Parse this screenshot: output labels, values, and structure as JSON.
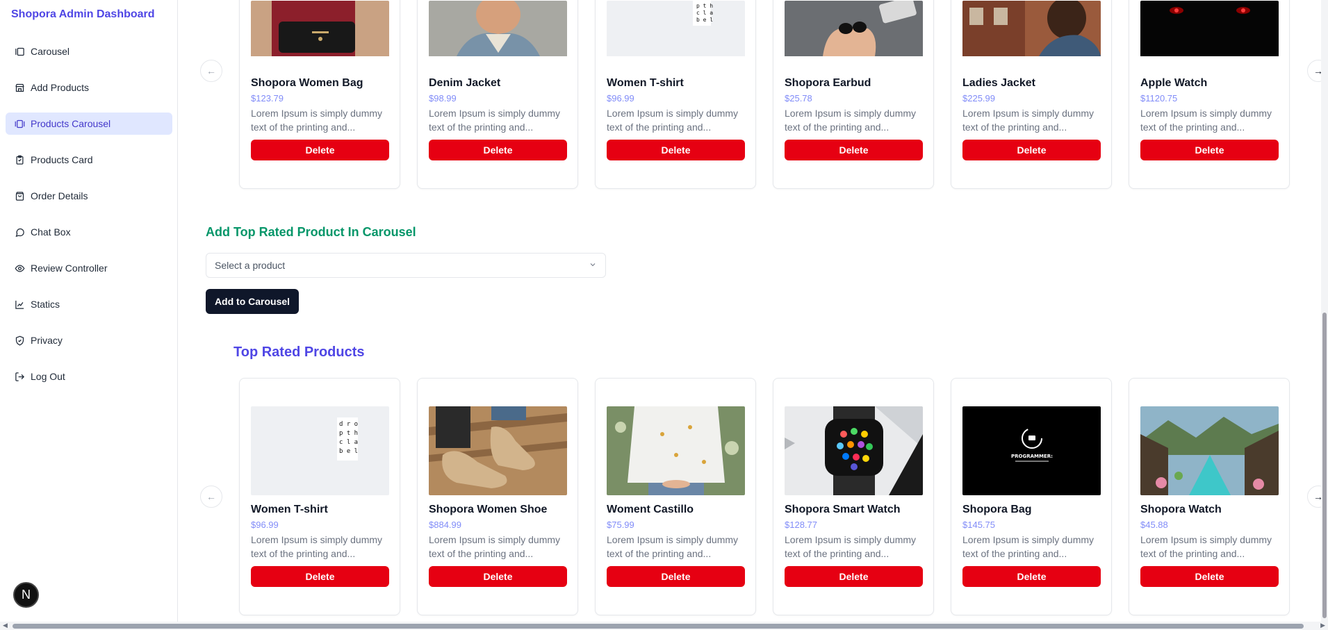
{
  "brand": "Shopora Admin Dashboard",
  "nav": [
    {
      "label": "Carousel",
      "icon": "carousel-icon"
    },
    {
      "label": "Add Products",
      "icon": "store-icon"
    },
    {
      "label": "Products Carousel",
      "icon": "carousel-icon",
      "active": true
    },
    {
      "label": "Products Card",
      "icon": "clipboard-icon"
    },
    {
      "label": "Order Details",
      "icon": "bag-icon"
    },
    {
      "label": "Chat Box",
      "icon": "message-icon"
    },
    {
      "label": "Review Controller",
      "icon": "eye-icon"
    },
    {
      "label": "Statics",
      "icon": "chart-icon"
    },
    {
      "label": "Privacy",
      "icon": "shield-icon"
    },
    {
      "label": "Log Out",
      "icon": "logout-icon"
    }
  ],
  "floating_badge": "N",
  "carousel_products": [
    {
      "name": "Shopora Women Bag",
      "price": "$123.79",
      "desc": "Lorem Ipsum is simply dummy text of the printing and...",
      "delete": "Delete"
    },
    {
      "name": "Denim Jacket",
      "price": "$98.99",
      "desc": "Lorem Ipsum is simply dummy text of the printing and...",
      "delete": "Delete"
    },
    {
      "name": "Women T-shirt",
      "price": "$96.99",
      "desc": "Lorem Ipsum is simply dummy text of the printing and...",
      "delete": "Delete"
    },
    {
      "name": "Shopora Earbud",
      "price": "$25.78",
      "desc": "Lorem Ipsum is simply dummy text of the printing and...",
      "delete": "Delete"
    },
    {
      "name": "Ladies Jacket",
      "price": "$225.99",
      "desc": "Lorem Ipsum is simply dummy text of the printing and...",
      "delete": "Delete"
    },
    {
      "name": "Apple Watch",
      "price": "$1120.75",
      "desc": "Lorem Ipsum is simply dummy text of the printing and...",
      "delete": "Delete"
    }
  ],
  "add_section": {
    "title": "Add Top Rated Product In Carousel",
    "select_placeholder": "Select a product",
    "button": "Add to Carousel"
  },
  "top_rated": {
    "title": "Top Rated Products",
    "products": [
      {
        "name": "Women T-shirt",
        "price": "$96.99",
        "desc": "Lorem Ipsum is simply dummy text of the printing and...",
        "delete": "Delete"
      },
      {
        "name": "Shopora Women Shoe",
        "price": "$884.99",
        "desc": "Lorem Ipsum is simply dummy text of the printing and...",
        "delete": "Delete"
      },
      {
        "name": "Woment Castillo",
        "price": "$75.99",
        "desc": "Lorem Ipsum is simply dummy text of the printing and...",
        "delete": "Delete"
      },
      {
        "name": "Shopora Smart Watch",
        "price": "$128.77",
        "desc": "Lorem Ipsum is simply dummy text of the printing and...",
        "delete": "Delete"
      },
      {
        "name": "Shopora Bag",
        "price": "$145.75",
        "desc": "Lorem Ipsum is simply dummy text of the printing and...",
        "delete": "Delete"
      },
      {
        "name": "Shopora Watch",
        "price": "$45.88",
        "desc": "Lorem Ipsum is simply dummy text of the printing and...",
        "delete": "Delete"
      }
    ]
  },
  "tshirt_print_text": "dro\npth\ncla\nbel",
  "programmer_image_text": "PROGRAMMER:",
  "colors": {
    "brand": "#4f46e5",
    "active_nav_bg": "#e0e7ff",
    "add_title": "#059669",
    "top_rated_title": "#4f46e5",
    "delete": "#e60012",
    "price": "#818cf8"
  }
}
